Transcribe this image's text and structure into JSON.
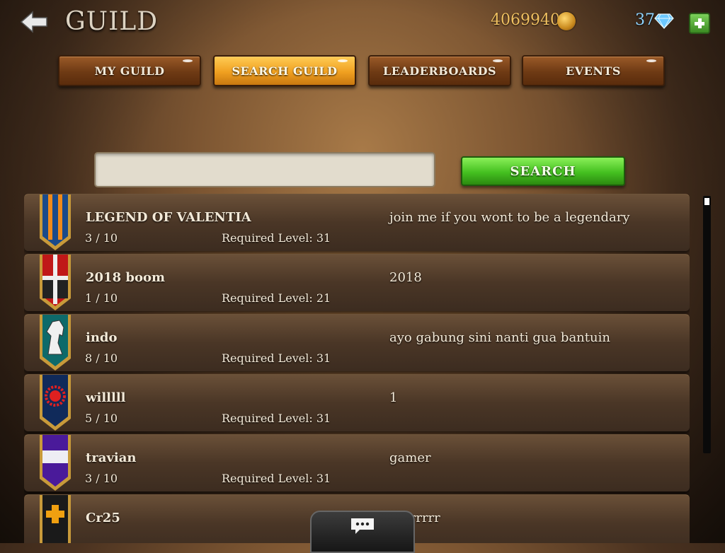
{
  "header": {
    "title": "GUILD",
    "gold": "4069940",
    "gems": "37"
  },
  "tabs": [
    {
      "label": "MY GUILD",
      "active": false
    },
    {
      "label": "SEARCH GUILD",
      "active": true
    },
    {
      "label": "LEADERBOARDS",
      "active": false
    },
    {
      "label": "EVENTS",
      "active": false
    }
  ],
  "search": {
    "value": "",
    "placeholder": "",
    "button_label": "SEARCH"
  },
  "guilds": [
    {
      "name": "LEGEND OF VALENTIA",
      "members": "3 / 10",
      "required": "Required Level: 31",
      "description": "join me if you wont to be a legendary",
      "banner": "blue-orange-stripes-banner"
    },
    {
      "name": "2018 boom",
      "members": "1 / 10",
      "required": "Required Level: 21",
      "description": "2018",
      "banner": "red-cross-banner"
    },
    {
      "name": "indo",
      "members": "8 / 10",
      "required": "Required Level: 31",
      "description": "ayo gabung sini nanti gua bantuin",
      "banner": "white-horse-banner"
    },
    {
      "name": "willlll",
      "members": "5 / 10",
      "required": "Required Level: 31",
      "description": "1",
      "banner": "red-sun-banner"
    },
    {
      "name": "travian",
      "members": "3 / 10",
      "required": "Required Level: 31",
      "description": "gamer",
      "banner": "purple-white-stripes-banner"
    },
    {
      "name": "Cr25",
      "members": "",
      "required": "",
      "description": "grrrrrrr",
      "banner": "orange-cross-banner"
    }
  ],
  "colors": {
    "active_tab": "#f0a020",
    "tab": "#6e3a14",
    "search_button": "#44c020",
    "gold_text": "#f0c060",
    "gem_text": "#8fd4ff"
  }
}
